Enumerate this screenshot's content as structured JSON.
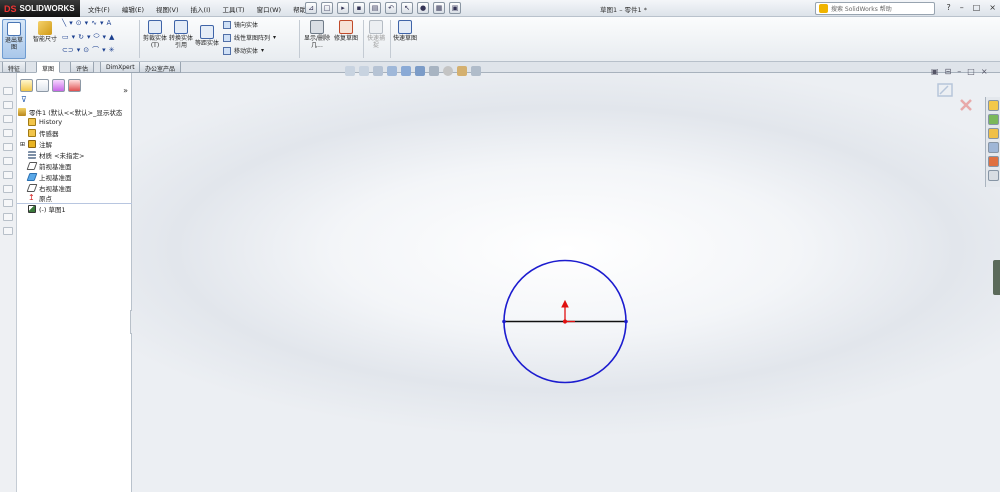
{
  "app": {
    "logo_text": "SOLIDWORKS",
    "logo_mark": "DS",
    "doc_title": "草图1 – 零件1 *",
    "menus": [
      "文件(F)",
      "编辑(E)",
      "视图(V)",
      "插入(I)",
      "工具(T)",
      "窗口(W)",
      "帮助(H)"
    ],
    "search_placeholder": "搜索 SolidWorks 帮助",
    "window_controls": [
      "?",
      "–",
      "□",
      "×"
    ]
  },
  "command_manager": {
    "exit_sketch": "退出草图",
    "smart_dimension": "智能尺寸",
    "trim": "剪裁实体(T)",
    "convert": "转换实体引用",
    "offset": "等距实体",
    "mirror": "镜向实体",
    "linear_pattern": "线性草图阵列",
    "move": "移动实体",
    "display_delete": "显示/删除几...",
    "repair": "修复草图",
    "quick_snaps": "快速捕捉",
    "rapid_sketch": "快速草图"
  },
  "tabs": [
    {
      "label": "特征",
      "active": false
    },
    {
      "label": "草图",
      "active": true
    },
    {
      "label": "评估",
      "active": false
    },
    {
      "label": "DimXpert",
      "active": false
    },
    {
      "label": "办公室产品",
      "active": false
    }
  ],
  "feature_tree": {
    "root": "零件1 (默认<<默认>_显示状态",
    "items": [
      {
        "label": "History",
        "icon": "history-icon",
        "color": "#f2c54a"
      },
      {
        "label": "传感器",
        "icon": "sensor-icon",
        "color": "#f2c54a"
      },
      {
        "label": "注解",
        "icon": "annotation-icon",
        "color": "#e8b322"
      },
      {
        "label": "材质 <未指定>",
        "icon": "material-icon",
        "color": "#7d8fa6"
      },
      {
        "label": "前视基准面",
        "icon": "plane-icon",
        "color": "#ffffff"
      },
      {
        "label": "上视基准面",
        "icon": "plane-icon",
        "color": "#59a8e8"
      },
      {
        "label": "右视基准面",
        "icon": "plane-icon",
        "color": "#ffffff"
      },
      {
        "label": "原点",
        "icon": "origin-icon",
        "color": "#d42020"
      },
      {
        "label": "(-) 草图1",
        "icon": "sketch-icon",
        "color": "#3b7a3b"
      }
    ]
  },
  "sketch": {
    "circle_color": "#1c1ccf",
    "line_color": "#111111",
    "origin_color": "#e01010"
  }
}
